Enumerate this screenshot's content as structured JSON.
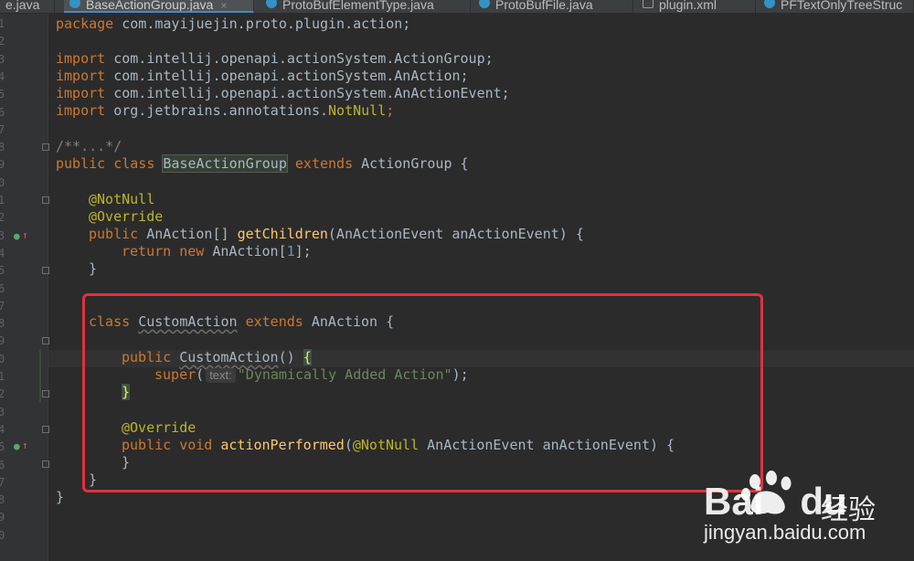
{
  "tabs": [
    {
      "label": "e.java",
      "active": false,
      "icon": "java-class-icon"
    },
    {
      "label": "BaseActionGroup.java",
      "active": true,
      "icon": "java-class-icon",
      "close": "×"
    },
    {
      "label": "ProtoBufElementType.java",
      "active": false,
      "icon": "java-class-icon"
    },
    {
      "label": "ProtoBufFile.java",
      "active": false,
      "icon": "java-class-icon"
    },
    {
      "label": "plugin.xml",
      "active": false,
      "icon": "xml-file-icon"
    },
    {
      "label": "PFTextOnlyTreeStruc",
      "active": false,
      "icon": "java-class-icon"
    }
  ],
  "line_numbers": [
    "1",
    "2",
    "3",
    "4",
    "5",
    "6",
    "7",
    "8",
    "9",
    "0",
    "1",
    "2",
    "3",
    "4",
    "5",
    "6",
    "7",
    "8",
    "9",
    "0",
    "1",
    "2",
    "3",
    "4",
    "5",
    "6",
    "7",
    "8",
    "9",
    "0"
  ],
  "code": {
    "l1": {
      "kw": "package",
      "rest": " com.mayijuejin.proto.plugin.action;"
    },
    "l3": {
      "kw": "import",
      "rest": " com.intellij.openapi.actionSystem.ActionGroup;"
    },
    "l4": {
      "kw": "import",
      "rest": " com.intellij.openapi.actionSystem.AnAction;"
    },
    "l5": {
      "kw": "import",
      "rest": " com.intellij.openapi.actionSystem.AnActionEvent;"
    },
    "l6": {
      "kw": "import",
      "rest": " org.jetbrains.annotations.",
      "ann": "NotNull",
      "end": ";"
    },
    "l8": {
      "text": "/**...*/"
    },
    "l9": {
      "kw1": "public class",
      "name": "BaseActionGroup",
      "kw2": "extends",
      "rest": " ActionGroup {"
    },
    "l11": {
      "ann": "@NotNull"
    },
    "l12": {
      "ann": "@Override"
    },
    "l13": {
      "kw": "public",
      "type": " AnAction[] ",
      "fn": "getChildren",
      "rest": "(AnActionEvent anActionEvent) {"
    },
    "l14": {
      "kw1": "return",
      "kw2": "new",
      "rest": " AnAction[",
      "num": "1",
      "end": "];"
    },
    "l15": {
      "text": "}"
    },
    "l17": {
      "kw1": "class",
      "name": "CustomAction",
      "kw2": "extends",
      "rest": " AnAction {"
    },
    "l19": {
      "kw": "public",
      "name": "CustomAction",
      "rest": "() ",
      "brace": "{"
    },
    "l20": {
      "kw": "super",
      "paren": "(",
      "hint": "text:",
      "str": "\"Dynamically Added Action\"",
      "end": ");"
    },
    "l21": {
      "brace": "}"
    },
    "l23": {
      "ann": "@Override"
    },
    "l24": {
      "kw": "public void",
      "fn": "actionPerformed",
      "paren": "(",
      "ann": "@NotNull",
      "rest": " AnActionEvent anActionEvent) {"
    },
    "l25": {
      "text": "}"
    },
    "l26": {
      "text": "}"
    },
    "l27": {
      "text": "}"
    }
  },
  "gutter_icons": {
    "impl": "●",
    "arrow": "↑"
  },
  "watermark": {
    "brand": "Bai",
    "brand2": "du",
    "cn": "经验",
    "url": "jingyan.baidu.com"
  },
  "colors": {
    "keyword": "#cc7832",
    "annotation": "#bbb529",
    "function": "#ffc66d",
    "string": "#6a8759",
    "number": "#6897bb",
    "highlight_box": "#e0323e"
  }
}
